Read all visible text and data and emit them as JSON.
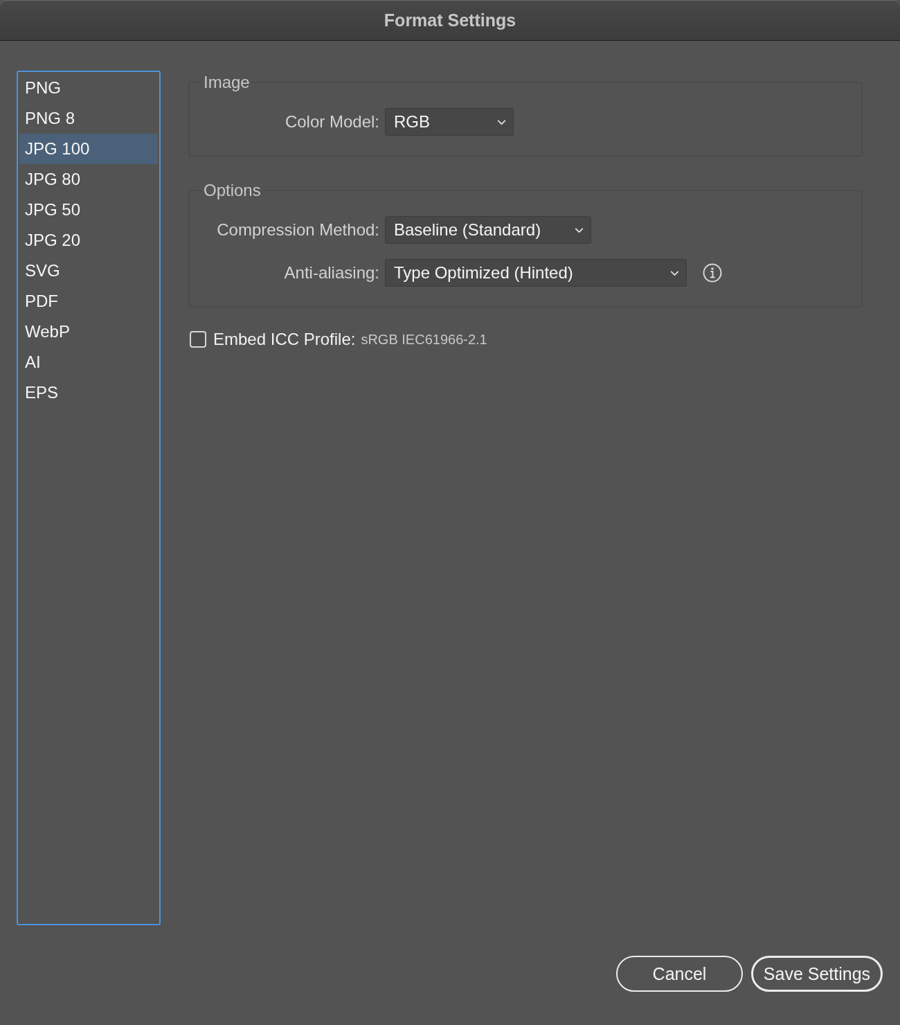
{
  "window": {
    "title": "Format Settings"
  },
  "formats": [
    {
      "label": "PNG",
      "selected": false
    },
    {
      "label": "PNG 8",
      "selected": false
    },
    {
      "label": "JPG 100",
      "selected": true
    },
    {
      "label": "JPG 80",
      "selected": false
    },
    {
      "label": "JPG 50",
      "selected": false
    },
    {
      "label": "JPG 20",
      "selected": false
    },
    {
      "label": "SVG",
      "selected": false
    },
    {
      "label": "PDF",
      "selected": false
    },
    {
      "label": "WebP",
      "selected": false
    },
    {
      "label": "AI",
      "selected": false
    },
    {
      "label": "EPS",
      "selected": false
    }
  ],
  "groups": [
    {
      "legend": "Image",
      "fields": [
        {
          "label": "Color Model:",
          "value": "RGB",
          "info": false
        }
      ]
    },
    {
      "legend": "Options",
      "fields": [
        {
          "label": "Compression Method:",
          "value": "Baseline (Standard)",
          "info": false
        },
        {
          "label": "Anti-aliasing:",
          "value": "Type Optimized (Hinted)",
          "info": true
        }
      ]
    }
  ],
  "embed_icc": {
    "label": "Embed ICC Profile:",
    "profile": "sRGB IEC61966-2.1",
    "checked": false
  },
  "buttons": [
    {
      "label": "Cancel",
      "kind": "cancel"
    },
    {
      "label": "Save Settings",
      "kind": "save"
    }
  ]
}
